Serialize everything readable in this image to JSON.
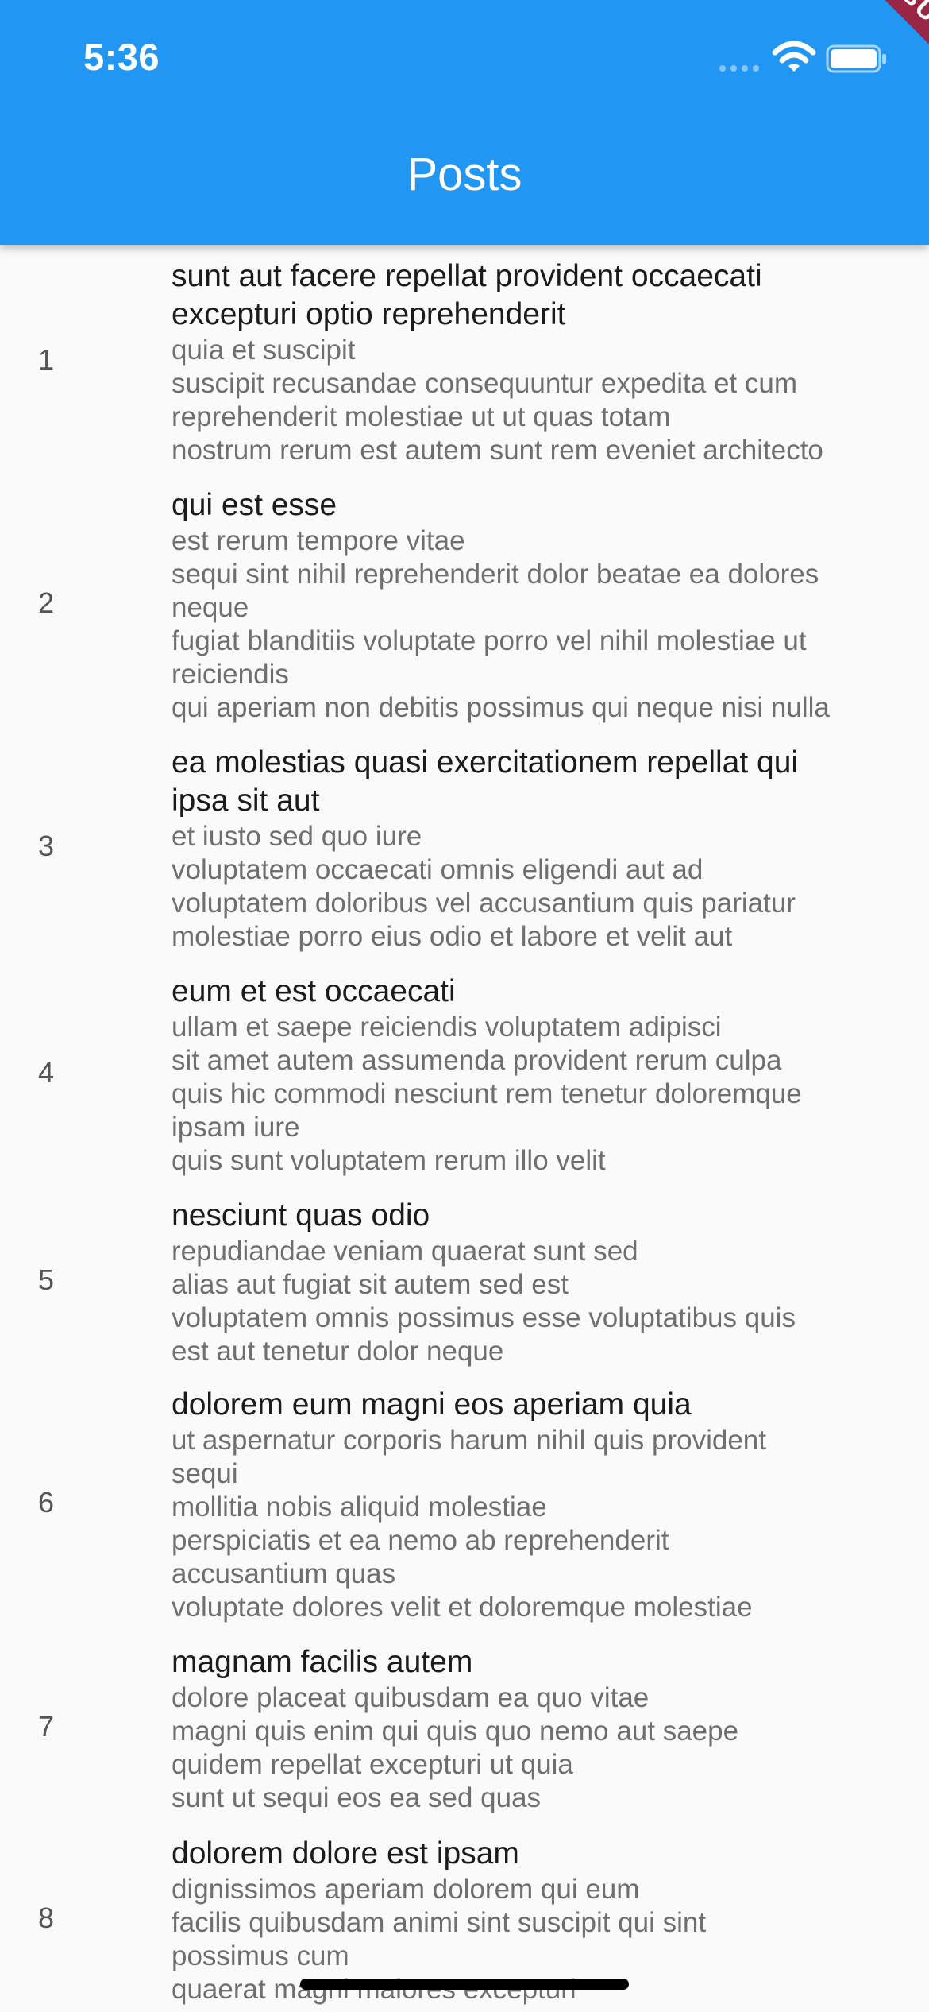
{
  "status_bar": {
    "time": "5:36"
  },
  "app_bar": {
    "title": "Posts",
    "debug_label": "DEBUG"
  },
  "posts": [
    {
      "id": "1",
      "title_lines": [
        "sunt aut facere repellat provident occaecati",
        "excepturi optio reprehenderit"
      ],
      "body_lines": [
        "quia et suscipit",
        "suscipit recusandae consequuntur expedita et cum",
        "reprehenderit molestiae ut ut quas totam",
        "nostrum rerum est autem sunt rem eveniet architecto"
      ]
    },
    {
      "id": "2",
      "title_lines": [
        "qui est esse"
      ],
      "body_lines": [
        "est rerum tempore vitae",
        "sequi sint nihil reprehenderit dolor beatae ea dolores",
        "neque",
        "fugiat blanditiis voluptate porro vel nihil molestiae ut",
        "reiciendis",
        "qui aperiam non debitis possimus qui neque nisi nulla"
      ]
    },
    {
      "id": "3",
      "title_lines": [
        "ea molestias quasi exercitationem repellat qui",
        "ipsa sit aut"
      ],
      "body_lines": [
        "et iusto sed quo iure",
        "voluptatem occaecati omnis eligendi aut ad",
        "voluptatem doloribus vel accusantium quis pariatur",
        "molestiae porro eius odio et labore et velit aut"
      ]
    },
    {
      "id": "4",
      "title_lines": [
        "eum et est occaecati"
      ],
      "body_lines": [
        "ullam et saepe reiciendis voluptatem adipisci",
        "sit amet autem assumenda provident rerum culpa",
        "quis hic commodi nesciunt rem tenetur doloremque",
        "ipsam iure",
        "quis sunt voluptatem rerum illo velit"
      ]
    },
    {
      "id": "5",
      "title_lines": [
        "nesciunt quas odio"
      ],
      "body_lines": [
        "repudiandae veniam quaerat sunt sed",
        "alias aut fugiat sit autem sed est",
        "voluptatem omnis possimus esse voluptatibus quis",
        "est aut tenetur dolor neque"
      ]
    },
    {
      "id": "6",
      "title_lines": [
        "dolorem eum magni eos aperiam quia"
      ],
      "body_lines": [
        "ut aspernatur corporis harum nihil quis provident",
        "sequi",
        "mollitia nobis aliquid molestiae",
        "perspiciatis et ea nemo ab reprehenderit",
        "accusantium quas",
        "voluptate dolores velit et doloremque molestiae"
      ]
    },
    {
      "id": "7",
      "title_lines": [
        "magnam facilis autem"
      ],
      "body_lines": [
        "dolore placeat quibusdam ea quo vitae",
        "magni quis enim qui quis quo nemo aut saepe",
        "quidem repellat excepturi ut quia",
        "sunt ut sequi eos ea sed quas"
      ]
    },
    {
      "id": "8",
      "title_lines": [
        "dolorem dolore est ipsam"
      ],
      "body_lines": [
        "dignissimos aperiam dolorem qui eum",
        "facilis quibusdam animi sint suscipit qui sint",
        "possimus cum",
        "quaerat magni maiores excepturi"
      ]
    }
  ]
}
